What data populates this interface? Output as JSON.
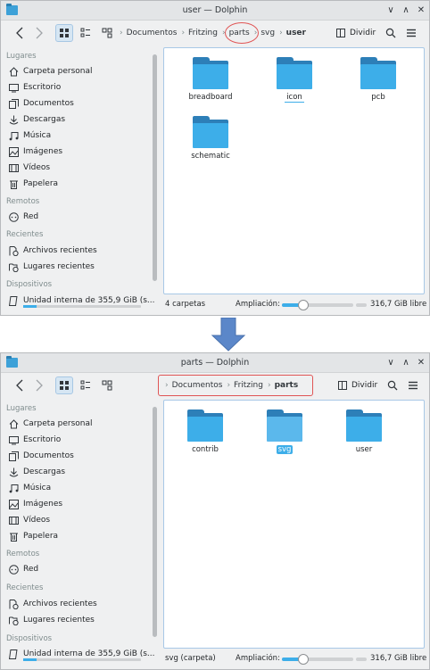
{
  "colors": {
    "accent": "#3daee9",
    "highlight": "#e05555",
    "arrow": "#5b87c9"
  },
  "sidebar": {
    "sections": {
      "places": "Lugares",
      "remote": "Remotos",
      "recent": "Recientes",
      "devices": "Dispositivos"
    },
    "places": [
      {
        "label": "Carpeta personal",
        "icon": "home-icon"
      },
      {
        "label": "Escritorio",
        "icon": "desktop-icon"
      },
      {
        "label": "Documentos",
        "icon": "documents-icon"
      },
      {
        "label": "Descargas",
        "icon": "download-icon"
      },
      {
        "label": "Música",
        "icon": "music-icon"
      },
      {
        "label": "Imágenes",
        "icon": "pictures-icon"
      },
      {
        "label": "Vídeos",
        "icon": "video-icon"
      },
      {
        "label": "Papelera",
        "icon": "trash-icon"
      }
    ],
    "remote": [
      {
        "label": "Red",
        "icon": "network-icon"
      }
    ],
    "recent": [
      {
        "label": "Archivos recientes",
        "icon": "recent-files-icon"
      },
      {
        "label": "Lugares recientes",
        "icon": "recent-places-icon"
      }
    ],
    "devices": [
      {
        "label": "Unidad interna de 355,9 GiB (s...",
        "icon": "drive-icon",
        "usage": 0.11
      }
    ]
  },
  "toolbar": {
    "split_label": "Dividir"
  },
  "window1": {
    "title": "user — Dolphin",
    "breadcrumb": [
      "Documentos",
      "Fritzing",
      "parts",
      "svg",
      "user"
    ],
    "folders": [
      "breadboard",
      "icon",
      "pcb",
      "schematic"
    ],
    "status": {
      "count": "4 carpetas",
      "zoom_label": "Ampliación:",
      "zoom_level": 0.3,
      "free": "316,7 GiB libre"
    }
  },
  "window2": {
    "title": "parts — Dolphin",
    "breadcrumb": [
      "Documentos",
      "Fritzing",
      "parts"
    ],
    "folders": [
      "contrib",
      "svg",
      "user"
    ],
    "status": {
      "count": "svg (carpeta)",
      "zoom_label": "Ampliación:",
      "zoom_level": 0.3,
      "free": "316,7 GiB libre"
    }
  }
}
